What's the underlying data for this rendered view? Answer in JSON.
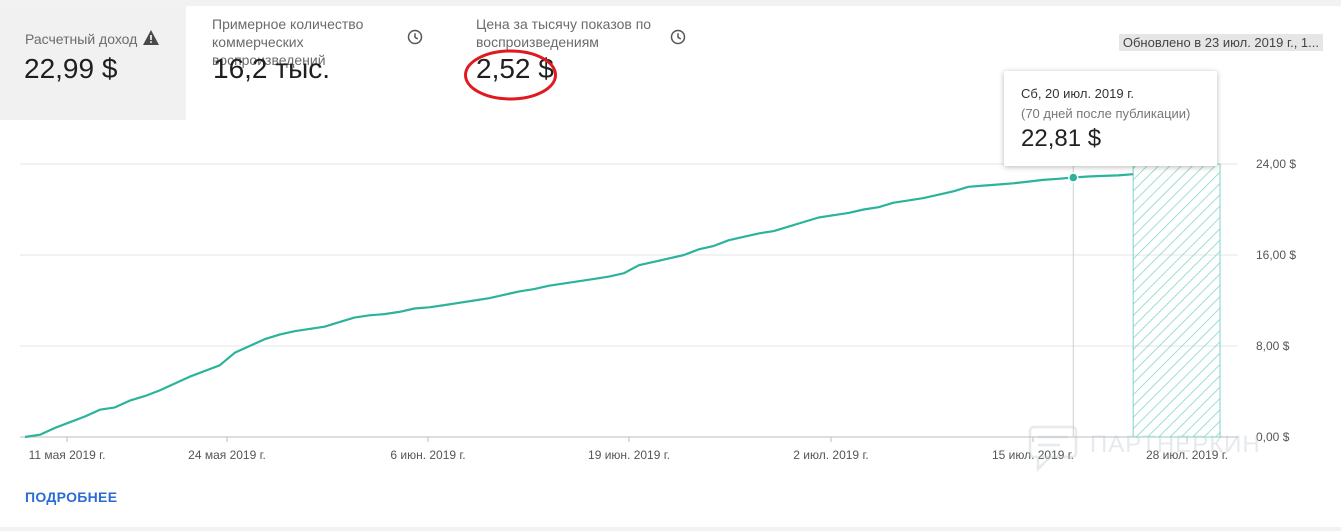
{
  "metrics": [
    {
      "label": "Расчетный доход",
      "value": "22,99 $",
      "icon": "warning-icon"
    },
    {
      "label": "Примерное количество коммерческих воспроизведений",
      "value": "16,2 тыс.",
      "icon": "clock-icon"
    },
    {
      "label": "Цена за тысячу показов по воспроизведениям",
      "value": "2,52 $",
      "icon": "clock-icon"
    }
  ],
  "updated": "Обновлено в 23 июл. 2019 г., 1...",
  "tooltip": {
    "date": "Сб, 20 июл. 2019 г.",
    "subtitle": "(70 дней после публикации)",
    "value": "22,81 $"
  },
  "more_link": "ПОДРОБНЕЕ",
  "watermark": "ПАРТНЕРКИН",
  "colors": {
    "line": "#2bb39b",
    "annotation": "#e0191f",
    "hatch": "#7fd3c4"
  },
  "chart_data": {
    "type": "line",
    "x_tick_labels": [
      "11 мая 2019 г.",
      "24 мая 2019 г.",
      "6 июн. 2019 г.",
      "19 июн. 2019 г.",
      "2 июл. 2019 г.",
      "15 июл. 2019 г.",
      "28 июл. 2019 г."
    ],
    "y_tick_labels": [
      "0,00 $",
      "8,00 $",
      "16,00 $",
      "24,00 $"
    ],
    "ylim": [
      0,
      24
    ],
    "grid": true,
    "highlight_index": 70,
    "projection_start_index": 74,
    "values": [
      0.0,
      0.2,
      0.8,
      1.3,
      1.8,
      2.4,
      2.6,
      3.2,
      3.6,
      4.1,
      4.7,
      5.3,
      5.8,
      6.3,
      7.4,
      8.0,
      8.6,
      9.0,
      9.3,
      9.5,
      9.7,
      10.1,
      10.5,
      10.7,
      10.8,
      11.0,
      11.3,
      11.4,
      11.6,
      11.8,
      12.0,
      12.2,
      12.5,
      12.8,
      13.0,
      13.3,
      13.5,
      13.7,
      13.9,
      14.1,
      14.4,
      15.1,
      15.4,
      15.7,
      16.0,
      16.5,
      16.8,
      17.3,
      17.6,
      17.9,
      18.1,
      18.5,
      18.9,
      19.3,
      19.5,
      19.7,
      20.0,
      20.2,
      20.6,
      20.8,
      21.0,
      21.3,
      21.6,
      22.0,
      22.1,
      22.2,
      22.3,
      22.45,
      22.6,
      22.7,
      22.81,
      22.9,
      22.95,
      23.0,
      23.1
    ]
  }
}
